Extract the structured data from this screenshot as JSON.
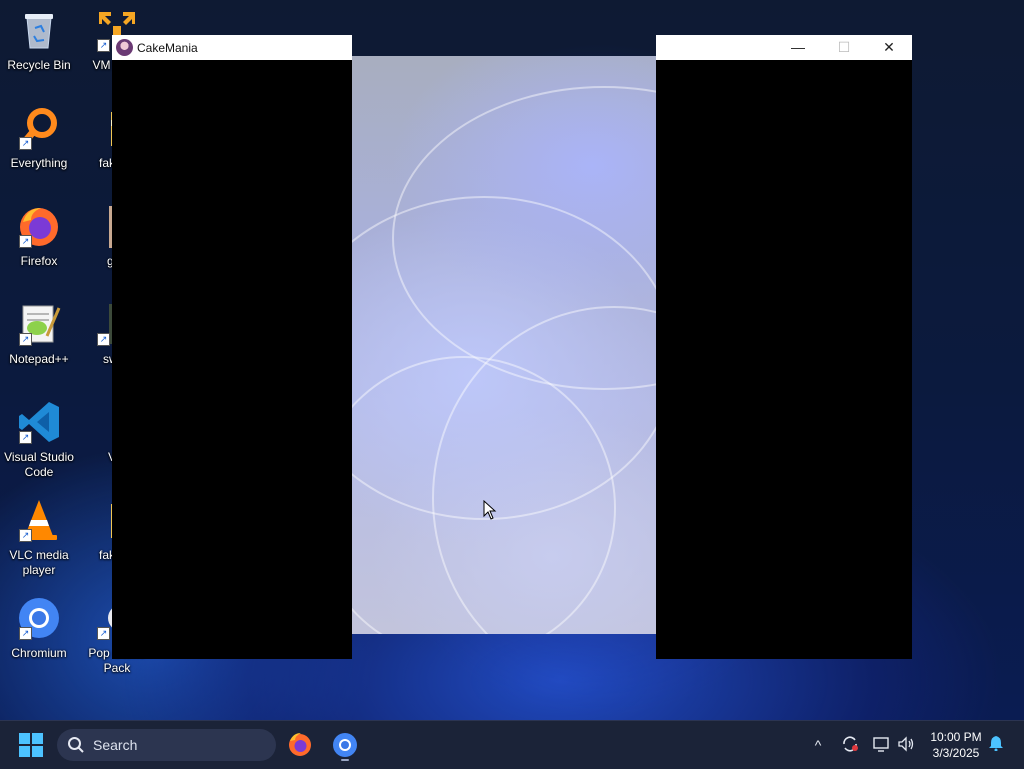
{
  "desktop": {
    "icons": [
      {
        "label": "Recycle Bin",
        "icon": "recycle-bin-icon"
      },
      {
        "label": "Everything",
        "icon": "everything-search-icon"
      },
      {
        "label": "Firefox",
        "icon": "firefox-icon"
      },
      {
        "label": "Notepad++",
        "icon": "notepadpp-icon"
      },
      {
        "label": "Visual Studio Code",
        "icon": "vscode-icon"
      },
      {
        "label": "VLC media player",
        "icon": "vlc-icon"
      },
      {
        "label": "Chromium",
        "icon": "chromium-icon"
      }
    ],
    "partial_icons": [
      {
        "label": "VM Work",
        "icon": "vmware-icon"
      },
      {
        "label": "fake_a",
        "icon": "folder-icon"
      },
      {
        "label": "gab",
        "icon": "photo-icon"
      },
      {
        "label": "swee",
        "icon": "photo-icon"
      },
      {
        "label": "VM",
        "icon": "shield-icon"
      },
      {
        "label": "fake_a",
        "icon": "folder-icon"
      },
      {
        "label": "Pop Game Pack",
        "icon": "game-pack-icon"
      }
    ]
  },
  "window": {
    "title": "CakeMania",
    "minimize": "—",
    "maximize": "☐",
    "close": "✕"
  },
  "taskbar": {
    "search_placeholder": "Search",
    "apps": [
      "firefox-icon",
      "chromium-icon"
    ],
    "tray": {
      "chevron": "^",
      "clock_time": "10:00 PM",
      "clock_date": "3/3/2025"
    }
  },
  "colors": {
    "taskbar_bg": "#1b2338",
    "start_blue": "#4cc2ff",
    "game_black": "#000000"
  }
}
